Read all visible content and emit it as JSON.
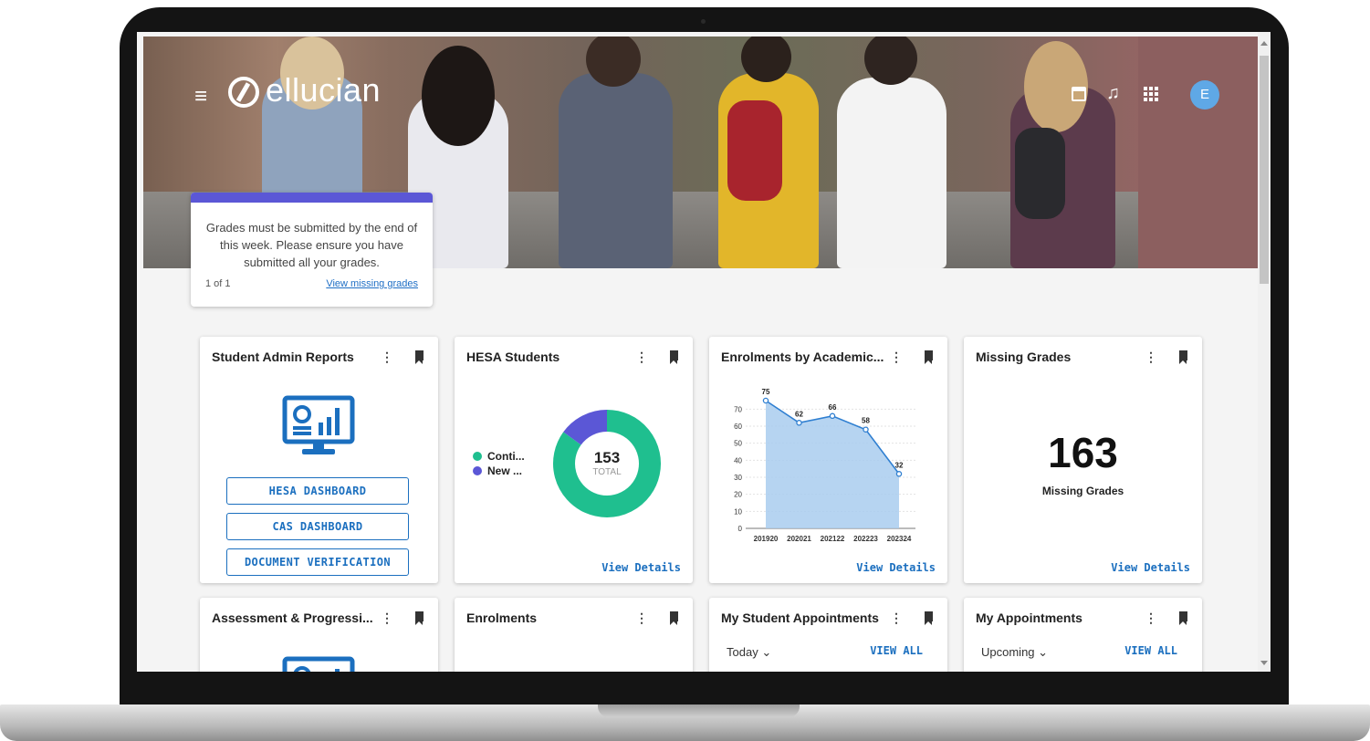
{
  "header": {
    "menu_icon": "hamburger-icon",
    "logo_text": "ellucian",
    "avatar_initial": "E"
  },
  "notification": {
    "message": "Grades must be submitted by the end of this week. Please ensure you have submitted all your grades.",
    "pager": "1 of 1",
    "link_text": "View missing grades",
    "accent_color": "#5b57d6"
  },
  "cards": {
    "student_admin": {
      "title": "Student Admin Reports",
      "icon": "monitor-report-icon",
      "buttons": [
        "HESA DASHBOARD",
        "CAS DASHBOARD",
        "DOCUMENT VERIFICATION"
      ]
    },
    "hesa": {
      "title": "HESA Students",
      "legend": [
        "Conti...",
        "New ..."
      ],
      "total_value": "153",
      "total_label": "TOTAL",
      "view_details": "View Details"
    },
    "enrolments_year": {
      "title": "Enrolments by Academic...",
      "view_details": "View Details"
    },
    "missing_grades": {
      "title": "Missing Grades",
      "value": "163",
      "label": "Missing Grades",
      "view_details": "View Details"
    },
    "assessment": {
      "title": "Assessment & Progressi..."
    },
    "enrolments": {
      "title": "Enrolments"
    },
    "student_appointments": {
      "title": "My Student Appointments",
      "filter": "Today",
      "view_all": "VIEW ALL"
    },
    "my_appointments": {
      "title": "My Appointments",
      "filter": "Upcoming",
      "view_all": "VIEW ALL"
    }
  },
  "colors": {
    "primary": "#1b6fbf",
    "donut_teal": "#1fbf8f",
    "donut_purple": "#5b57d6",
    "area_fill": "#a9cdee",
    "line": "#2f7fd1"
  },
  "chart_data": [
    {
      "type": "pie",
      "labels": [
        "Conti...",
        "New ..."
      ],
      "values": [
        130,
        23
      ],
      "total": 153
    },
    {
      "type": "area",
      "categories": [
        "201920",
        "202021",
        "202122",
        "202223",
        "202324"
      ],
      "values": [
        75,
        62,
        66,
        58,
        32
      ],
      "ylim": [
        0,
        75
      ],
      "yticks": [
        0,
        10,
        20,
        30,
        40,
        50,
        60,
        70
      ],
      "grid": true
    }
  ]
}
